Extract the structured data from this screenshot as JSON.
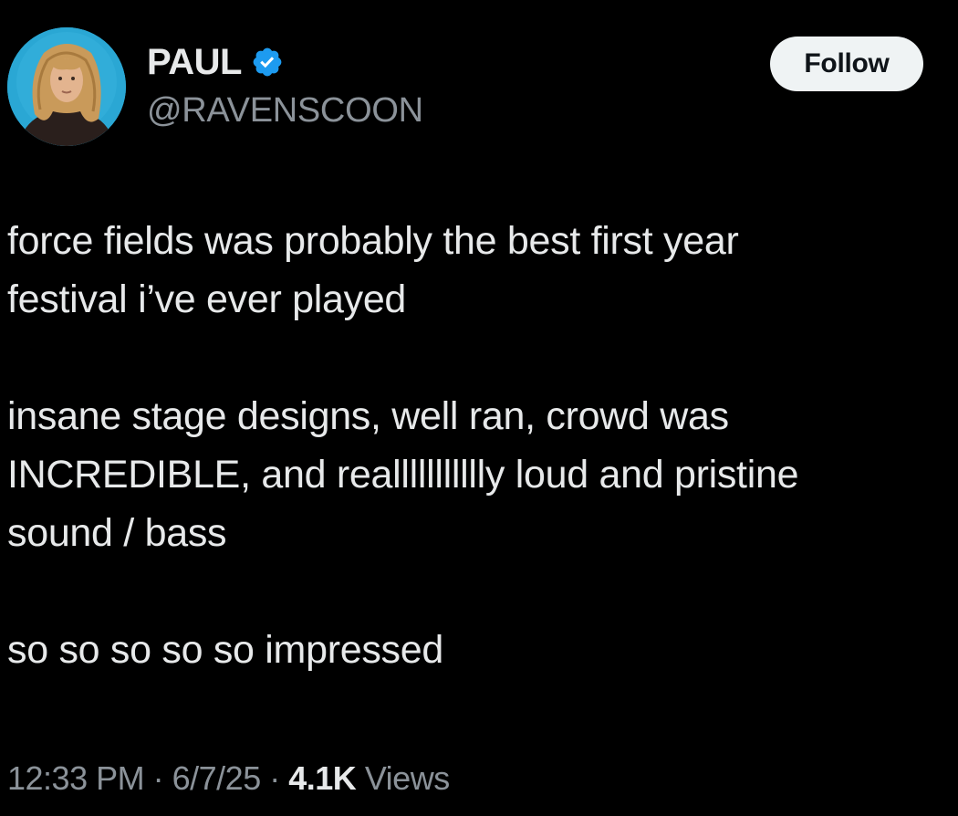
{
  "author": {
    "display_name": "PAUL",
    "handle": "@RAVENSCOON",
    "verified_icon": "verified-badge-icon",
    "verified_color": "#1d9bf0",
    "avatar_icon": "profile-photo"
  },
  "follow_button": {
    "label": "Follow"
  },
  "tweet": {
    "paragraphs": [
      "force fields was probably the best first year\nfestival i’ve ever played",
      "insane stage designs, well ran, crowd was\nINCREDIBLE, and reallllllllllly loud and pristine\nsound / bass",
      "so so so so so impressed"
    ]
  },
  "meta": {
    "time": "12:33 PM",
    "separator": "·",
    "date": "6/7/25",
    "views_count": "4.1K",
    "views_label": "Views"
  },
  "colors": {
    "background": "#000000",
    "text": "#e7e9ea",
    "secondary_text": "#8b9299",
    "follow_bg": "#eff3f4",
    "follow_text": "#0f1419"
  }
}
